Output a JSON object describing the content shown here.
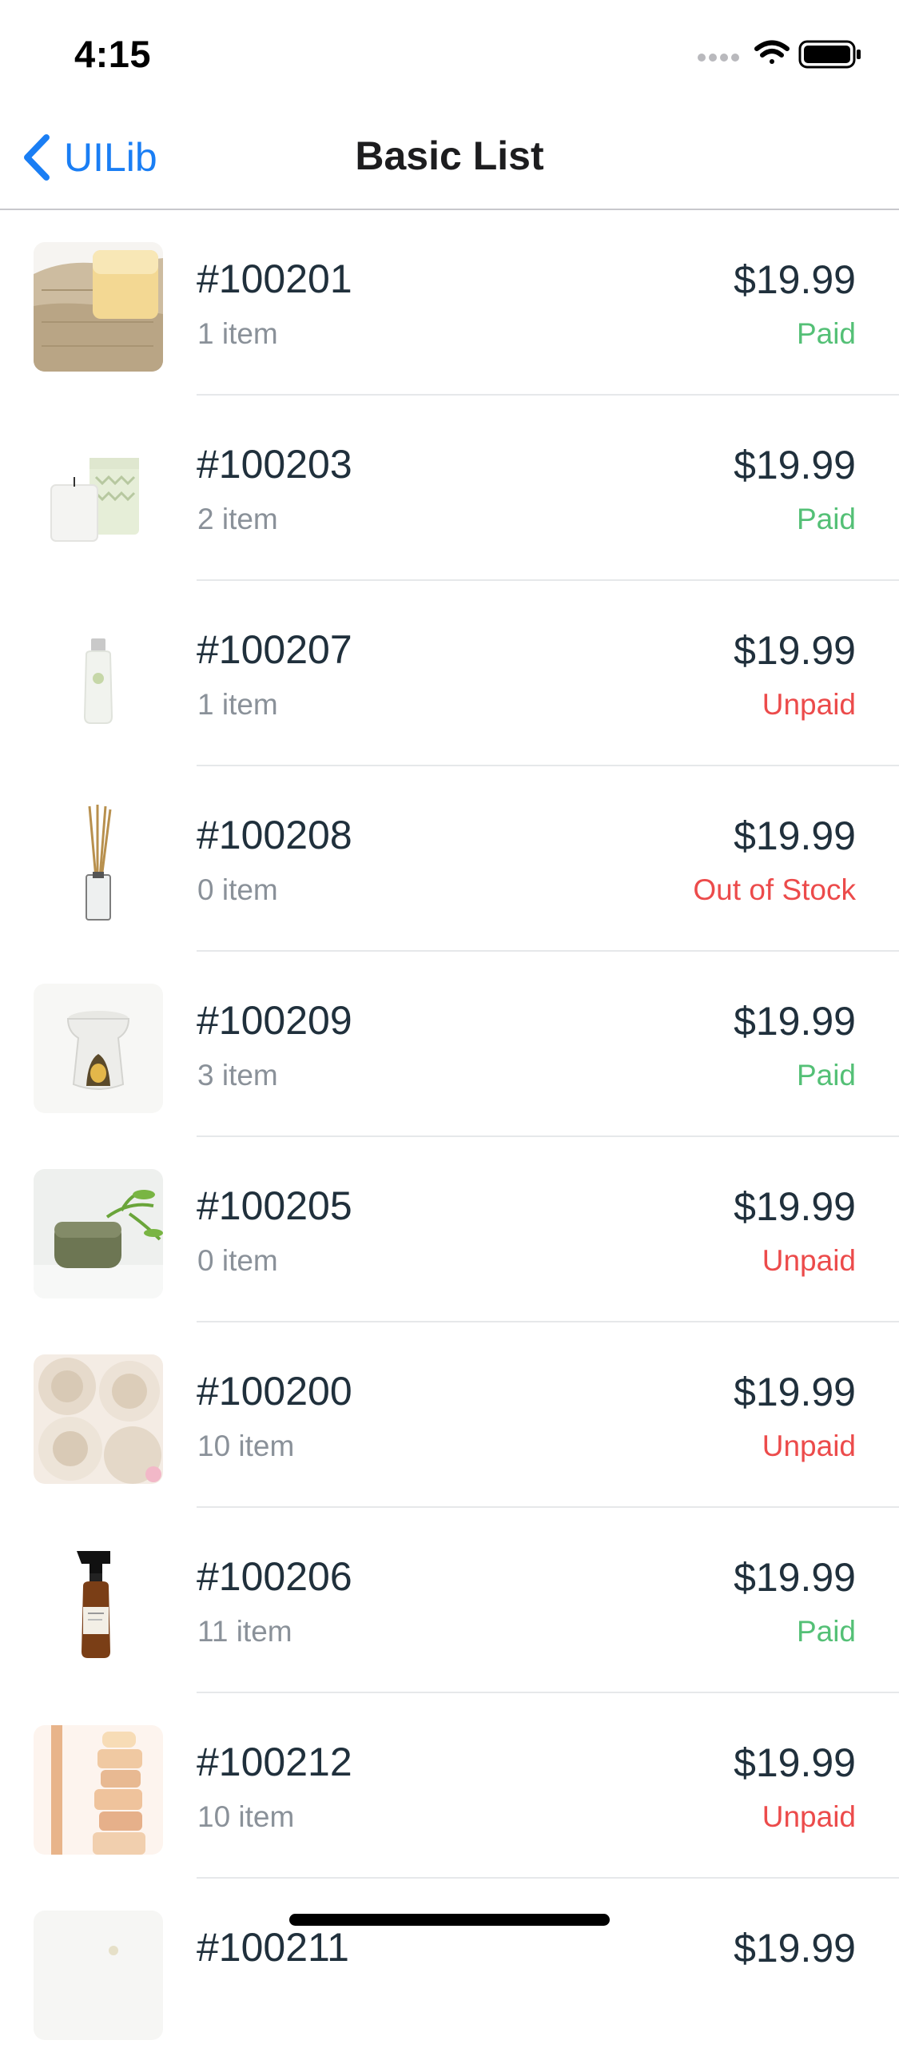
{
  "status_bar": {
    "time": "4:15"
  },
  "nav": {
    "back_label": "UILib",
    "title": "Basic List"
  },
  "colors": {
    "accent": "#1a7ef4",
    "paid": "#54c076",
    "unpaid": "#ec4b4b",
    "text": "#20303c",
    "secondary": "#8a9199"
  },
  "orders": [
    {
      "image": "loofah-soap",
      "id": "#100201",
      "count": "1 item",
      "price": "$19.99",
      "status": "Paid",
      "status_type": "paid"
    },
    {
      "image": "candle",
      "id": "#100203",
      "count": "2 item",
      "price": "$19.99",
      "status": "Paid",
      "status_type": "paid"
    },
    {
      "image": "lotion-bottle",
      "id": "#100207",
      "count": "1 item",
      "price": "$19.99",
      "status": "Unpaid",
      "status_type": "unpaid"
    },
    {
      "image": "reed-diffuser",
      "id": "#100208",
      "count": "0 item",
      "price": "$19.99",
      "status": "Out of Stock",
      "status_type": "unpaid"
    },
    {
      "image": "oil-burner",
      "id": "#100209",
      "count": "3 item",
      "price": "$19.99",
      "status": "Paid",
      "status_type": "paid"
    },
    {
      "image": "herbal-soap",
      "id": "#100205",
      "count": "0 item",
      "price": "$19.99",
      "status": "Unpaid",
      "status_type": "unpaid"
    },
    {
      "image": "rolled-towels",
      "id": "#100200",
      "count": "10 item",
      "price": "$19.99",
      "status": "Unpaid",
      "status_type": "unpaid"
    },
    {
      "image": "spray-bottle",
      "id": "#100206",
      "count": "11 item",
      "price": "$19.99",
      "status": "Paid",
      "status_type": "paid"
    },
    {
      "image": "soap-stack",
      "id": "#100212",
      "count": "10 item",
      "price": "$19.99",
      "status": "Unpaid",
      "status_type": "unpaid"
    },
    {
      "image": "product",
      "id": "#100211",
      "count": "",
      "price": "$19.99",
      "status": "",
      "status_type": "paid"
    }
  ]
}
